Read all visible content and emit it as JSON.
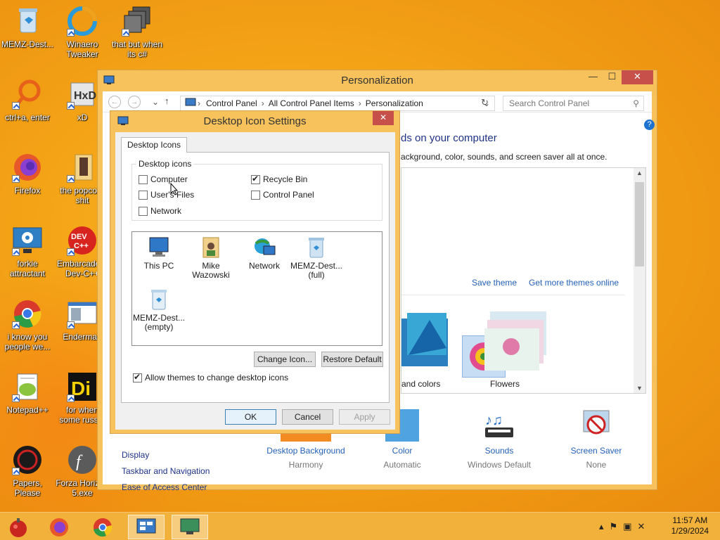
{
  "desktop": {
    "icons": [
      {
        "label": "MEMZ-Dest..."
      },
      {
        "label": "Winaero Tweaker"
      },
      {
        "label": "that but when its c#"
      },
      {
        "label": "ctrl+a, enter"
      },
      {
        "label": "xD"
      },
      {
        "label": "Firefox"
      },
      {
        "label": "the popcorn shit"
      },
      {
        "label": "forkie attractant"
      },
      {
        "label": "Embarcadero Dev-C++"
      },
      {
        "label": "i know you people we..."
      },
      {
        "label": "Enderman"
      },
      {
        "label": "Notepad++"
      },
      {
        "label": "for when some russ..."
      },
      {
        "label": "Papers, Please"
      },
      {
        "label": "Forza Horizon 5.exe"
      }
    ]
  },
  "personalization": {
    "title": "Personalization",
    "breadcrumb": [
      "Control Panel",
      "All Control Panel Items",
      "Personalization"
    ],
    "search_placeholder": "Search Control Panel",
    "heading": "ds on your computer",
    "subheading": "ackground, color, sounds, and screen saver all at once.",
    "save_theme": "Save theme",
    "get_more": "Get more themes online",
    "theme_partial_label": "and colors",
    "theme_flowers": "Flowers",
    "left_links": [
      "Display",
      "Taskbar and Navigation",
      "Ease of Access Center"
    ],
    "bottom": [
      {
        "label": "Desktop Background",
        "sub": "Harmony"
      },
      {
        "label": "Color",
        "sub": "Automatic"
      },
      {
        "label": "Sounds",
        "sub": "Windows Default"
      },
      {
        "label": "Screen Saver",
        "sub": "None"
      }
    ]
  },
  "dialog": {
    "title": "Desktop Icon Settings",
    "tab": "Desktop Icons",
    "group_label": "Desktop icons",
    "checkboxes": [
      {
        "label": "Computer",
        "checked": false
      },
      {
        "label": "Recycle Bin",
        "checked": true
      },
      {
        "label": "User's Files",
        "checked": false
      },
      {
        "label": "Control Panel",
        "checked": false
      },
      {
        "label": "Network",
        "checked": false
      }
    ],
    "list": [
      {
        "label": "This PC"
      },
      {
        "label": "Mike Wazowski"
      },
      {
        "label": "Network"
      },
      {
        "label": "MEMZ-Dest... (full)"
      },
      {
        "label": "MEMZ-Dest... (empty)"
      }
    ],
    "change_icon": "Change Icon...",
    "restore_default": "Restore Default",
    "allow_themes": "Allow themes to change desktop icons",
    "allow_themes_checked": true,
    "ok": "OK",
    "cancel": "Cancel",
    "apply": "Apply"
  },
  "taskbar": {
    "time": "11:57 AM",
    "date": "1/29/2024"
  }
}
